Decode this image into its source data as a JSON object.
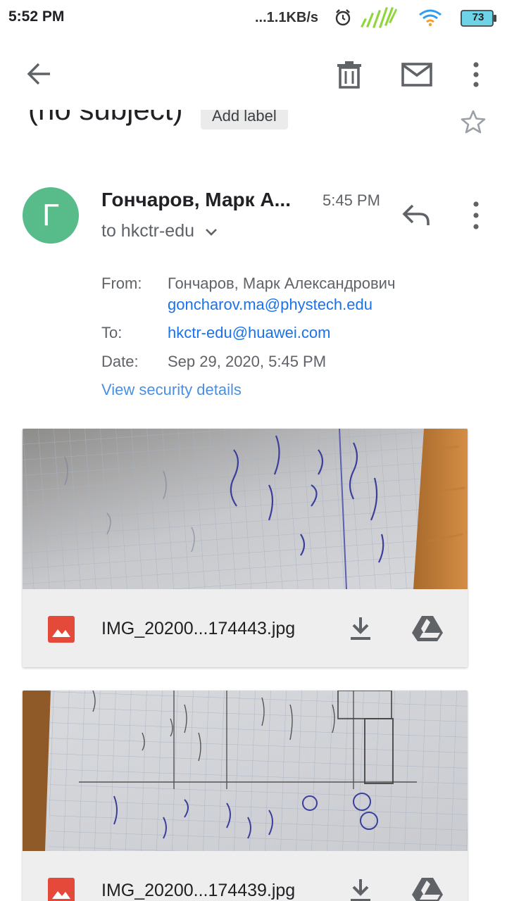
{
  "status_bar": {
    "time": "5:52 PM",
    "network_speed": "...1.1KB/s",
    "battery": "73"
  },
  "toolbar": {
    "back_icon": "arrow-back-icon",
    "delete_icon": "trash-icon",
    "mark_unread_icon": "mail-icon",
    "more_icon": "more-vert-icon"
  },
  "message": {
    "subject": "(no subject)",
    "add_label": "Add label",
    "avatar_letter": "Г",
    "avatar_color": "#57bb8a",
    "sender_short": "Гончаров, Марк А...",
    "time": "5:45 PM",
    "to_short": "to hkctr-edu",
    "details": {
      "from_label": "From:",
      "from_name": "Гончаров, Марк Александрович",
      "from_email": "goncharov.ma@phystech.edu",
      "to_label": "To:",
      "to_email": "hkctr-edu@huawei.com",
      "date_label": "Date:",
      "date_value": "Sep 29, 2020, 5:45 PM"
    },
    "view_security": "View security details"
  },
  "attachments": [
    {
      "name": "IMG_20200...174443.jpg"
    },
    {
      "name": "IMG_20200...174439.jpg"
    }
  ],
  "colors": {
    "link": "#1a73e8",
    "accent_link": "#4a8fe0",
    "image_icon": "#e5493a"
  }
}
